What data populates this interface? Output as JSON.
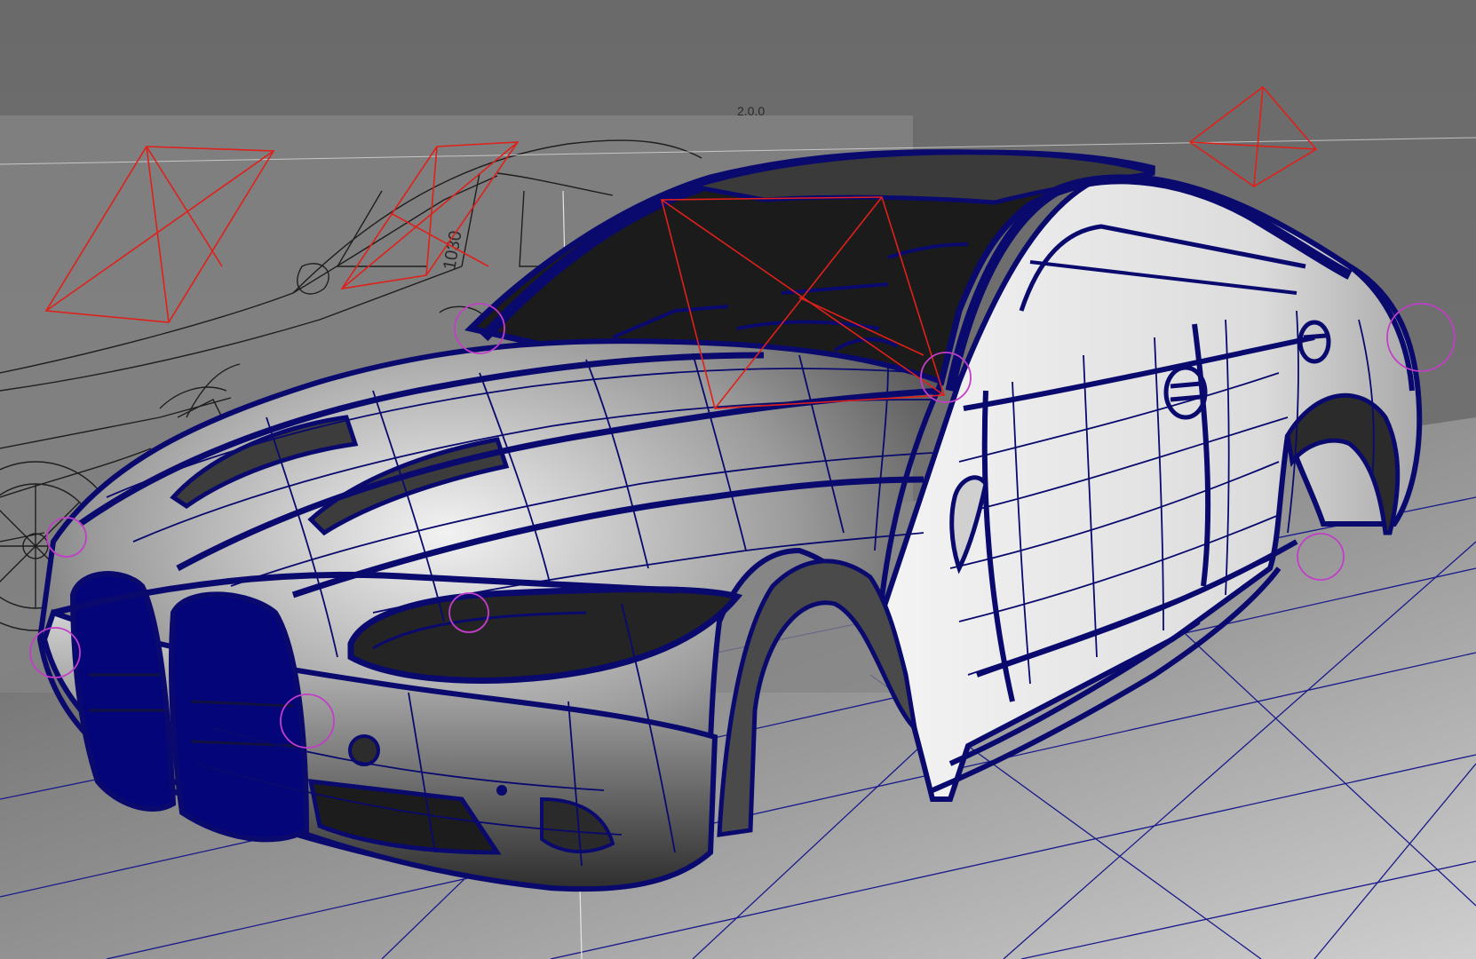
{
  "viewport": {
    "kind": "3D modeling viewport (perspective)",
    "dimension_top": "2.0.0",
    "dimension_side": "1030"
  },
  "colors": {
    "background_top": "#6e6e6e",
    "background_bottom": "#8a8a8a",
    "floor": "#9a9a9a",
    "grid_line": "#1a1a8a",
    "wireframe": "#0a0a6e",
    "camera_gizmo": "#e0201a",
    "pivot_handle": "#c23ec8",
    "reference_sketch": "#1e1e1e",
    "surface_light": "#e9e9e9",
    "surface_dark": "#2a2a2a"
  },
  "icons": [
    "camera-gizmo-icon",
    "pivot-handle-icon"
  ]
}
